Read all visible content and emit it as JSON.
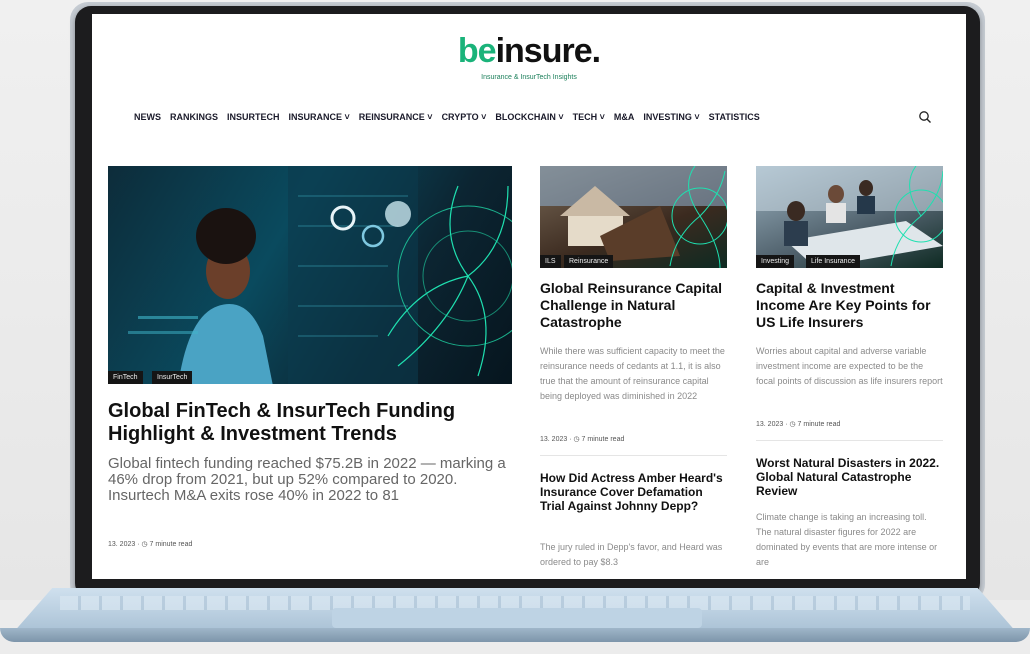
{
  "site": {
    "logo_be": "be",
    "logo_rest": "insure.",
    "tagline": "Insurance & InsurTech Insights"
  },
  "nav": {
    "items": [
      "NEWS",
      "RANKINGS",
      "INSURTECH",
      "INSURANCE ˅",
      "REINSURANCE ˅",
      "CRYPTO ˅",
      "BLOCKCHAIN ˅",
      "TECH ˅",
      "M&A",
      "INVESTING ˅",
      "STATISTICS"
    ],
    "search_icon": "search-icon"
  },
  "featured": {
    "tags": [
      "FinTech",
      "InsurTech"
    ],
    "title": "Global FinTech & InsurTech Funding Highlight & Investment Trends",
    "excerpt": "Global fintech funding reached $75.2B in 2022 — marking a 46% drop from 2021, but up 52% compared to 2020. Insurtech M&A exits rose 40% in 2022 to 81",
    "date": "13. 2023",
    "read": "7 minute read"
  },
  "col2": {
    "top": {
      "tags": [
        "ILS",
        "Reinsurance"
      ],
      "title": "Global Reinsurance Capital Challenge in Natural Catastrophe",
      "excerpt": "While there was sufficient capacity to meet the reinsurance needs of cedants at 1.1, it is also true that the amount of reinsurance capital being deployed was diminished in 2022",
      "date": "13. 2023",
      "read": "7 minute read"
    },
    "bottom": {
      "title": "How Did Actress Amber Heard's Insurance Cover Defamation Trial Against Johnny Depp?",
      "excerpt": "The jury ruled in Depp's favor, and Heard was ordered to pay $8.3"
    }
  },
  "col3": {
    "top": {
      "tags": [
        "Investing",
        "Life Insurance"
      ],
      "title": "Capital & Investment Income Are Key Points for US Life Insurers",
      "excerpt": "Worries about capital and adverse variable investment income are expected to be the focal points of discussion as life insurers report",
      "date": "13. 2023",
      "read": "7 minute read"
    },
    "bottom": {
      "title": "Worst Natural Disasters in 2022. Global Natural Catastrophe Review",
      "excerpt": "Climate change is taking an increasing toll. The natural disaster figures for 2022 are dominated by events that are more intense or are"
    }
  },
  "colors": {
    "brand": "#1ab37a",
    "tag_bg": "#151515"
  }
}
